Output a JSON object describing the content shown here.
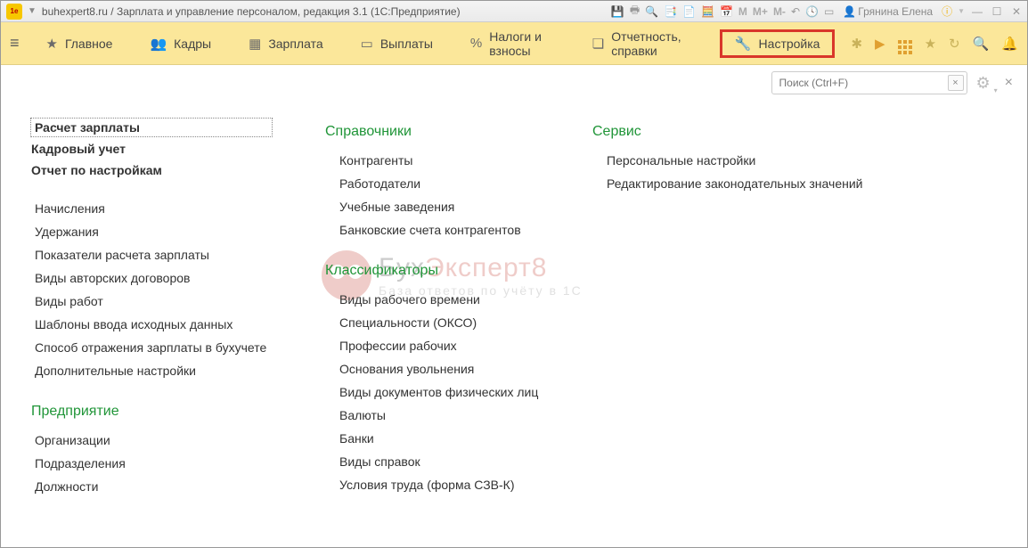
{
  "titlebar": {
    "title": "buhexpert8.ru / Зарплата и управление персоналом, редакция 3.1  (1С:Предприятие)",
    "user": "Грянина Елена",
    "m_labels": [
      "M",
      "M+",
      "M-"
    ]
  },
  "nav": {
    "items": [
      {
        "label": "Главное",
        "icon": "★"
      },
      {
        "label": "Кадры",
        "icon": "👥"
      },
      {
        "label": "Зарплата",
        "icon": "▦"
      },
      {
        "label": "Выплаты",
        "icon": "▭"
      },
      {
        "label": "Налоги и взносы",
        "icon": "%"
      },
      {
        "label": "Отчетность, справки",
        "icon": "❏"
      },
      {
        "label": "Настройка",
        "icon": "🔧",
        "active": true
      }
    ]
  },
  "search": {
    "placeholder": "Поиск (Ctrl+F)"
  },
  "col1": {
    "bold_links": [
      "Расчет зарплаты",
      "Кадровый учет",
      "Отчет по настройкам"
    ],
    "links1": [
      "Начисления",
      "Удержания",
      "Показатели расчета зарплаты",
      "Виды авторских договоров",
      "Виды работ",
      "Шаблоны ввода исходных данных",
      "Способ отражения зарплаты в бухучете",
      "Дополнительные настройки"
    ],
    "group2_title": "Предприятие",
    "links2": [
      "Организации",
      "Подразделения",
      "Должности"
    ]
  },
  "col2": {
    "group1_title": "Справочники",
    "links1": [
      "Контрагенты",
      "Работодатели",
      "Учебные заведения",
      "Банковские счета контрагентов"
    ],
    "group2_title": "Классификаторы",
    "links2": [
      "Виды рабочего времени",
      "Специальности (ОКСО)",
      "Профессии рабочих",
      "Основания увольнения",
      "Виды документов физических лиц",
      "Валюты",
      "Банки",
      "Виды справок",
      "Условия труда (форма СЗВ-К)"
    ]
  },
  "col3": {
    "group1_title": "Сервис",
    "links1": [
      "Персональные настройки",
      "Редактирование законодательных значений"
    ]
  },
  "watermark": {
    "brand_prefix": "Бух",
    "brand_suffix": "Эксперт8",
    "tagline": "База ответов по учёту в 1С"
  }
}
